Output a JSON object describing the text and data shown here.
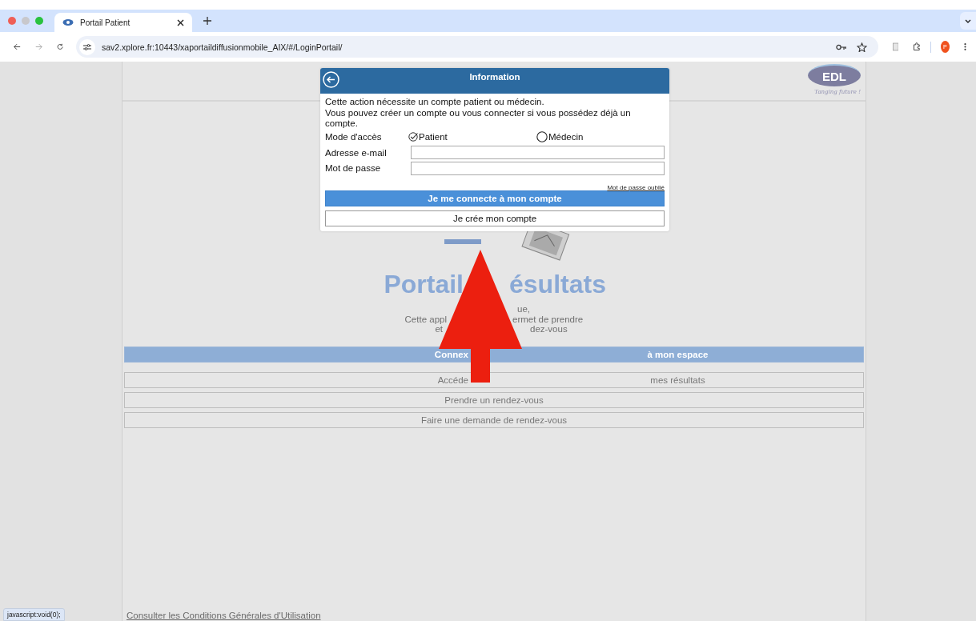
{
  "browser": {
    "tab_title": "Portail Patient",
    "url": "sav2.xplore.fr:10443/xaportaildiffusionmobile_AIX/#/LoginPortail/",
    "profile_initial": "P"
  },
  "page": {
    "logo": {
      "name": "EDL",
      "tagline": "Tanging future !"
    },
    "heading": {
      "left": "Portail",
      "right": "ésultats"
    },
    "intro_lines": [
      {
        "right": "ue,"
      },
      {
        "left": "Cette appl",
        "right": "ermet de prendre"
      },
      {
        "left": "et",
        "right": "dez-vous"
      }
    ],
    "buttons": [
      {
        "kind": "primary",
        "left": "Connex",
        "right": "à mon espace"
      },
      {
        "kind": "secondary",
        "left": "Accéde",
        "right": "mes résultats"
      },
      {
        "kind": "secondary",
        "left": "Prendre un rendez-vous"
      },
      {
        "kind": "secondary",
        "left": "Faire une demande de rendez-vous"
      }
    ],
    "footer_link": "Consulter les Conditions Générales d'Utilisation"
  },
  "dialog": {
    "title": "Information",
    "message": "Cette action nécessite un compte patient ou médecin.\nVous pouvez créer un compte ou vous connecter si vous possédez déjà un compte.",
    "access_mode": {
      "label": "Mode d'accès",
      "options": [
        {
          "label": "Patient",
          "selected": true
        },
        {
          "label": "Médecin",
          "selected": false
        }
      ]
    },
    "fields": [
      {
        "label": "Adresse e-mail"
      },
      {
        "label": "Mot de passe"
      }
    ],
    "forgot_link": "Mot de passe oublié",
    "login_button": "Je me connecte à mon compte",
    "create_button": "Je crée mon compte"
  },
  "status_bubble": "javascript:void(0);"
}
